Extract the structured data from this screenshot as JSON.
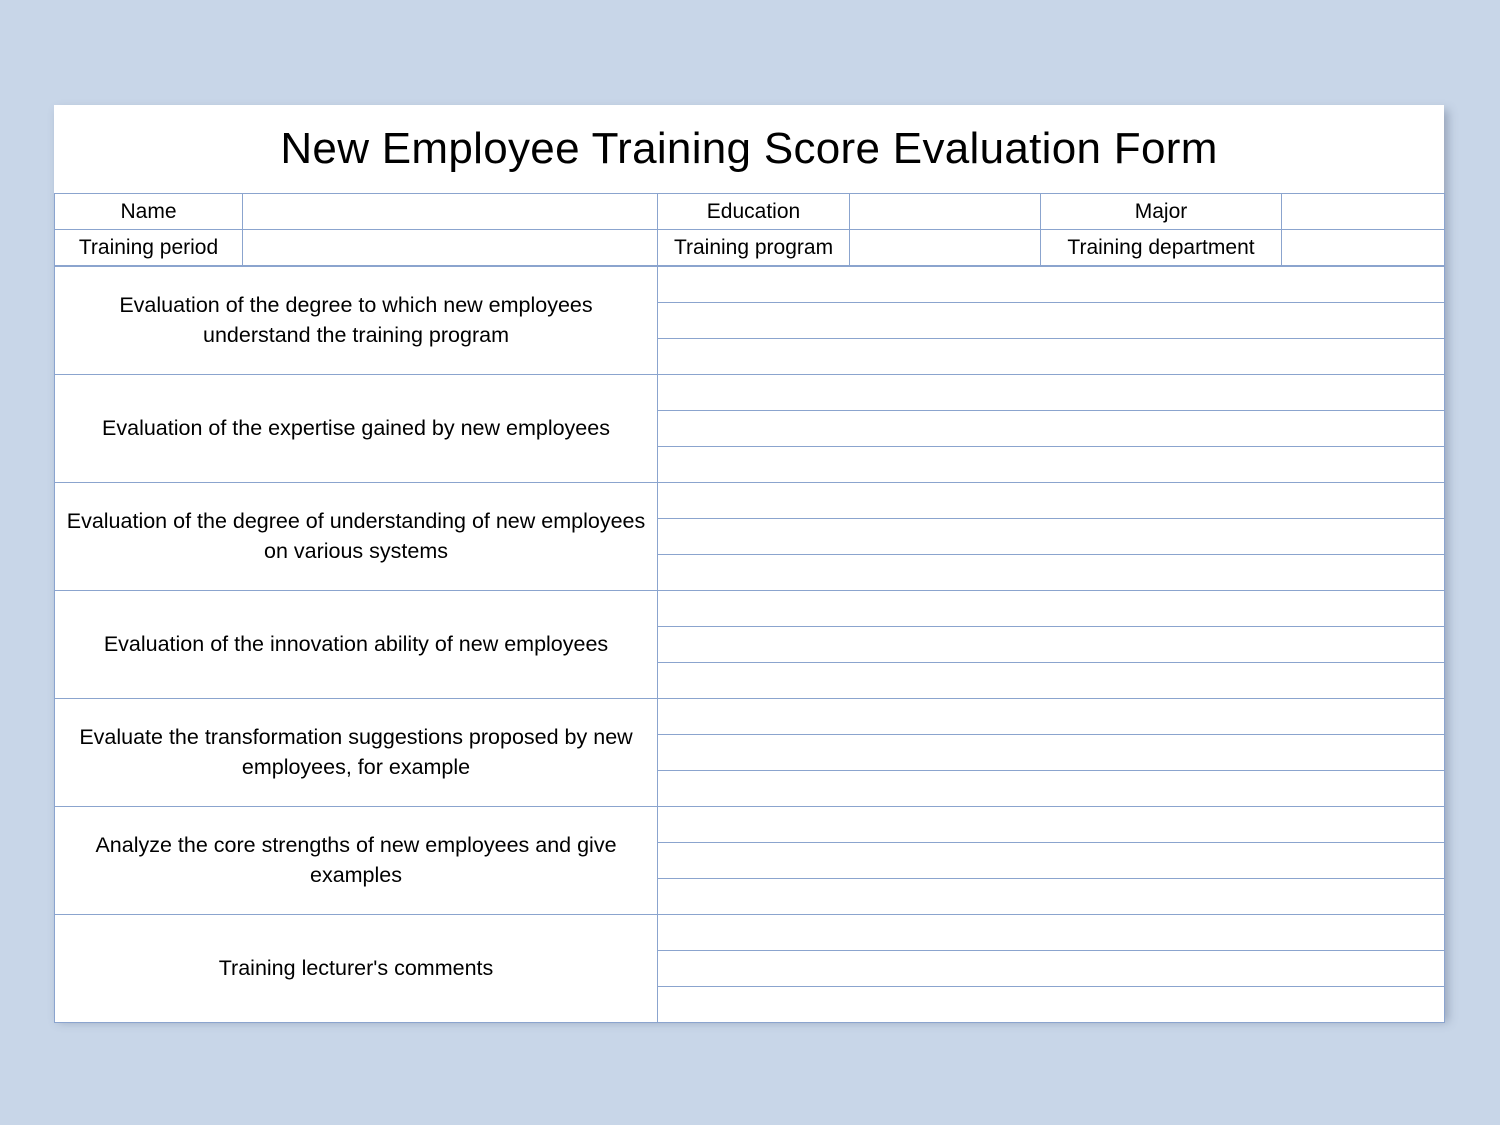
{
  "document": {
    "title": "New Employee Training Score Evaluation Form",
    "background_color": "#c8d6e8",
    "paper_color": "#ffffff",
    "grid_line_color": "#8ba4ce"
  },
  "info_rows": [
    {
      "fields": [
        {
          "label": "Name",
          "value": ""
        },
        {
          "label": "Education",
          "value": ""
        },
        {
          "label": "Major",
          "value": ""
        }
      ]
    },
    {
      "fields": [
        {
          "label": "Training period",
          "value": ""
        },
        {
          "label": "Training program",
          "value": ""
        },
        {
          "label": "Training department",
          "value": ""
        }
      ]
    }
  ],
  "evaluation_rows": [
    {
      "label": "Evaluation of the degree to which new employees understand the training program",
      "lines": [
        "",
        "",
        ""
      ]
    },
    {
      "label": "Evaluation of the expertise gained by new employees",
      "lines": [
        "",
        "",
        ""
      ]
    },
    {
      "label": "Evaluation of the degree of understanding of new employees on various systems",
      "lines": [
        "",
        "",
        ""
      ]
    },
    {
      "label": "Evaluation of the innovation ability of new employees",
      "lines": [
        "",
        "",
        ""
      ]
    },
    {
      "label": "Evaluate the transformation suggestions proposed by new employees, for example",
      "lines": [
        "",
        "",
        ""
      ]
    },
    {
      "label": "Analyze the core strengths of new employees and give examples",
      "lines": [
        "",
        "",
        ""
      ]
    },
    {
      "label": "Training lecturer's comments",
      "lines": [
        "",
        "",
        ""
      ]
    }
  ]
}
